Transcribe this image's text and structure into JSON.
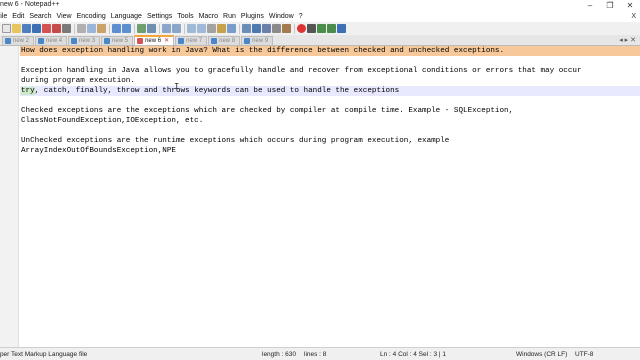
{
  "window": {
    "title": "new 6 - Notepad++",
    "min_symbol": "–",
    "max_symbol": "❐",
    "close_symbol": "✕"
  },
  "menu": {
    "items": [
      "File",
      "Edit",
      "Search",
      "View",
      "Encoding",
      "Language",
      "Settings",
      "Tools",
      "Macro",
      "Run",
      "Plugins",
      "Window",
      "?"
    ],
    "close_symbol": "X"
  },
  "tabs": [
    {
      "label": "new 2",
      "active": false
    },
    {
      "label": "new 4",
      "active": false
    },
    {
      "label": "new 3",
      "active": false
    },
    {
      "label": "new 5",
      "active": false
    },
    {
      "label": "new 6",
      "active": true
    },
    {
      "label": "new 7",
      "active": false
    },
    {
      "label": "new 8",
      "active": false
    },
    {
      "label": "new 9",
      "active": false
    }
  ],
  "tab_close_symbol": "✕",
  "tab_arrows": "◂ ▸ ✕",
  "editor": {
    "lines": [
      "How does exception handling work in Java? What is the difference between checked and unchecked exceptions.",
      "",
      "Exception handling in Java allows you to gracefully handle and recover from exceptional conditions or errors that may occur",
      "during program execution.",
      "try, catch, finally, throw and throws keywords can be used to handle the exceptions",
      "",
      "Checked exceptions are the exceptions which are checked by compiler at compile time. Example - SQLException,",
      "ClassNotFoundException,IOException, etc.",
      "",
      "UnChecked exceptions are the runtime exceptions which occurs during program execution, example",
      "ArrayIndexOutOfBoundsException,NPE"
    ],
    "try_word": "try",
    "try_rest": ", catch, finally, throw and throws keywords can be used to handle the exceptions",
    "cursor_glyph": "I"
  },
  "status": {
    "file_type": "Hyper Text Markup Language file",
    "length": "length : 630",
    "lines": "lines : 8",
    "position": "Ln : 4    Col : 4    Sel : 3 | 1",
    "eol": "Windows (CR LF)",
    "encoding": "UTF-8"
  },
  "colors": {
    "highlight_line": "#f7c99a",
    "active_tab_accent": "#f4a63b",
    "tab_close": "#c0392b"
  }
}
